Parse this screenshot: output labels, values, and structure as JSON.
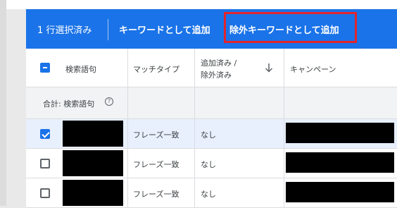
{
  "action_bar": {
    "selected_count": "1 行選択済み",
    "add_as_keyword": "キーワードとして追加",
    "add_as_negative_keyword": "除外キーワードとして追加",
    "color": "#1a73e8"
  },
  "annotation": {
    "highlight_color": "#e3242b"
  },
  "table": {
    "columns": {
      "search_term": "検索語句",
      "match_type": "マッチタイプ",
      "added_excluded_line1": "追加済み /",
      "added_excluded_line2": "除外済み",
      "campaign": "キャンペーン"
    },
    "sort_icon": "arrow-down-icon",
    "total_label": "合計: 検索語句",
    "rows": [
      {
        "checked": true,
        "match_type": "フレーズ一致",
        "status": "なし"
      },
      {
        "checked": false,
        "match_type": "フレーズ一致",
        "status": "なし"
      },
      {
        "checked": false,
        "match_type": "フレーズ一致",
        "status": "なし"
      }
    ]
  }
}
